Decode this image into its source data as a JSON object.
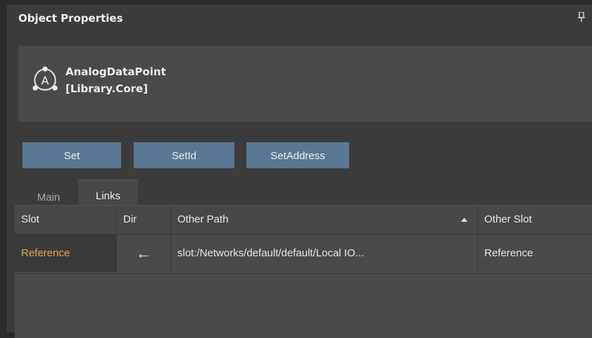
{
  "panel": {
    "title": "Object Properties",
    "pin_icon": "pin-icon"
  },
  "object": {
    "icon": "analog-point-icon",
    "icon_glyph": "A",
    "name": "AnalogDataPoint",
    "library": "[Library.Core]"
  },
  "actions": {
    "set_label": "Set",
    "setid_label": "SetId",
    "setaddress_label": "SetAddress"
  },
  "tabs": [
    {
      "label": "Main",
      "active": false
    },
    {
      "label": "Links",
      "active": true
    }
  ],
  "links_table": {
    "columns": [
      "Slot",
      "Dir",
      "Other Path",
      "Other Slot"
    ],
    "sorted_column": "Other Path",
    "sort_direction": "ascending",
    "rows": [
      {
        "slot": "Reference",
        "dir": "←",
        "other_path": "slot:/Networks/default/default/Local IO...",
        "other_slot": "Reference"
      }
    ]
  },
  "colors": {
    "panel_bg": "#3c3c3c",
    "card_bg": "#4a4a4a",
    "button_bg": "#5a7893",
    "slot_text": "#e0a94b"
  }
}
